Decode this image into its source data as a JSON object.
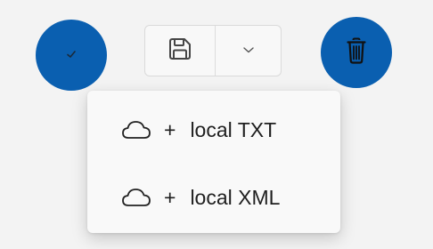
{
  "toolbar": {
    "confirm_icon": "checkmark-icon",
    "save_icon": "save-icon",
    "dropdown_icon": "chevron-down-icon",
    "delete_icon": "trash-icon",
    "accent": "#0a5fb0"
  },
  "menu": {
    "items": [
      {
        "icon": "cloud-icon",
        "plus": "+",
        "label": "local TXT"
      },
      {
        "icon": "cloud-icon",
        "plus": "+",
        "label": "local XML"
      }
    ]
  }
}
